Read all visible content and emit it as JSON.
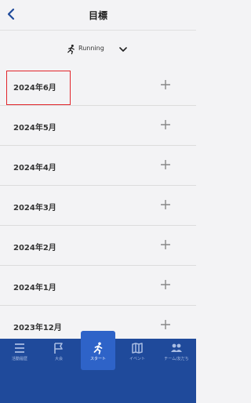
{
  "header": {
    "title": "目標"
  },
  "filter": {
    "activity_label": "Running"
  },
  "months": [
    "2024年6月",
    "2024年5月",
    "2024年4月",
    "2024年3月",
    "2024年2月",
    "2024年1月",
    "2023年12月"
  ],
  "tabbar": {
    "tabs": [
      {
        "label": "活動履歴"
      },
      {
        "label": "大会"
      },
      {
        "label": "スタート"
      },
      {
        "label": "イベント"
      },
      {
        "label": "チーム/友だち"
      }
    ]
  },
  "colors": {
    "tabbar_bg": "#1f4a9b",
    "tab_active_bg": "#2e63c8",
    "highlight_border": "#e2242a",
    "accent_blue": "#1f4a9b"
  },
  "icons": {
    "back": "chevron-left-icon",
    "activity": "running-icon",
    "dropdown": "chevron-down-icon",
    "row_action": "plus-icon"
  }
}
